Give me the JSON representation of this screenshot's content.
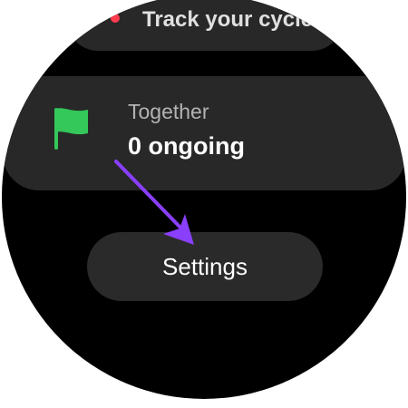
{
  "top_card": {
    "partial_label": "...",
    "title": "Track your cycle.",
    "dot_color": "#ff3b4e"
  },
  "together_card": {
    "icon": "flag-icon",
    "icon_color": "#34c759",
    "title": "Together",
    "value": "0 ongoing"
  },
  "settings_button": {
    "label": "Settings"
  },
  "annotation": {
    "icon": "arrow-icon",
    "color": "#8a3ffc"
  }
}
